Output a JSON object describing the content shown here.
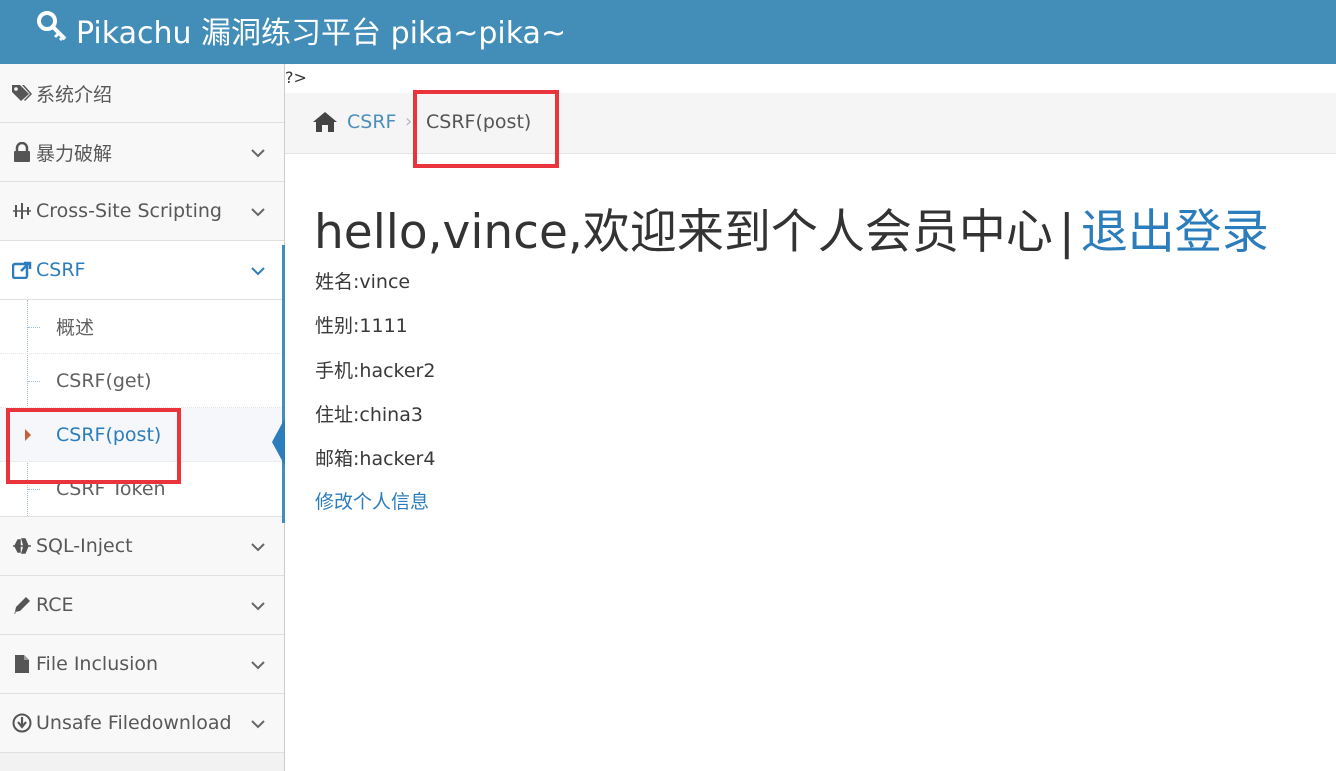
{
  "navbar": {
    "brand_text": "Pikachu 漏洞练习平台 pika~pika~",
    "brand_icon": "key-icon"
  },
  "sidebar": {
    "items": [
      {
        "label": "系统介绍",
        "icon": "tags-icon"
      },
      {
        "label": "暴力破解",
        "icon": "lock-icon"
      },
      {
        "label": "Cross-Site Scripting",
        "icon": "sliders-icon"
      },
      {
        "label": "CSRF",
        "icon": "share-icon"
      },
      {
        "label": "SQL-Inject",
        "icon": "plane-icon"
      },
      {
        "label": "RCE",
        "icon": "pencil-icon"
      },
      {
        "label": "File Inclusion",
        "icon": "file-icon"
      },
      {
        "label": "Unsafe Filedownload",
        "icon": "download-icon"
      }
    ],
    "csrf_subitems": [
      "概述",
      "CSRF(get)",
      "CSRF(post)",
      "CSRF Token"
    ]
  },
  "page": {
    "stray_text": "?>",
    "breadcrumb": {
      "parent": "CSRF",
      "current": "CSRF(post)"
    },
    "greeting": "hello,vince,欢迎来到个人会员中心",
    "separator": "|",
    "logout": "退出登录",
    "fields": [
      "姓名:vince",
      "性别:1111",
      "手机:hacker2",
      "住址:china3",
      "邮箱:hacker4"
    ],
    "edit_link": "修改个人信息"
  },
  "colors": {
    "navbar": "#438eb9",
    "link": "#2b7dbc",
    "highlight": "#e8343a"
  }
}
